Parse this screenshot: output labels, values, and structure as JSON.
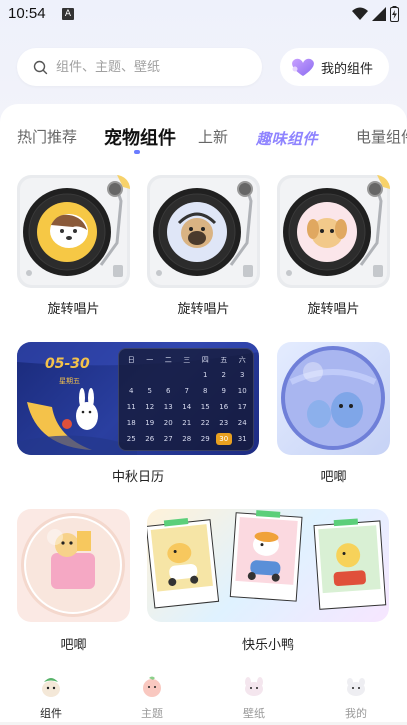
{
  "status": {
    "time": "10:54",
    "notif": "A"
  },
  "search": {
    "placeholder": "组件、主题、壁纸"
  },
  "my_widgets": {
    "label": "我的组件"
  },
  "tabs": [
    {
      "label": "热门推荐"
    },
    {
      "label": "宠物组件"
    },
    {
      "label": "上新"
    },
    {
      "label": "趣味组件"
    },
    {
      "label": "电量组件"
    }
  ],
  "widgets": [
    {
      "label": "旋转唱片"
    },
    {
      "label": "旋转唱片"
    },
    {
      "label": "旋转唱片"
    },
    {
      "label": "中秋日历"
    },
    {
      "label": "吧唧"
    },
    {
      "label": "吧唧"
    },
    {
      "label": "快乐小鸭"
    }
  ],
  "calendar": {
    "date": "05-30",
    "weekday": "星期五",
    "headers": [
      "日",
      "一",
      "二",
      "三",
      "四",
      "五",
      "六"
    ],
    "rows": [
      [
        "",
        "",
        "",
        "",
        "1",
        "2",
        "3"
      ],
      [
        "4",
        "5",
        "6",
        "7",
        "8",
        "9",
        "10"
      ],
      [
        "11",
        "12",
        "13",
        "14",
        "15",
        "16",
        "17"
      ],
      [
        "18",
        "19",
        "20",
        "21",
        "22",
        "23",
        "24"
      ],
      [
        "25",
        "26",
        "27",
        "28",
        "29",
        "30",
        "31"
      ]
    ],
    "highlight": "30"
  },
  "nav": [
    {
      "label": "组件"
    },
    {
      "label": "主题"
    },
    {
      "label": "壁纸"
    },
    {
      "label": "我的"
    }
  ],
  "colors": {
    "accent": "#6b7cff",
    "fun_tab": "#8f84ff",
    "highlight": "#e8a020"
  }
}
